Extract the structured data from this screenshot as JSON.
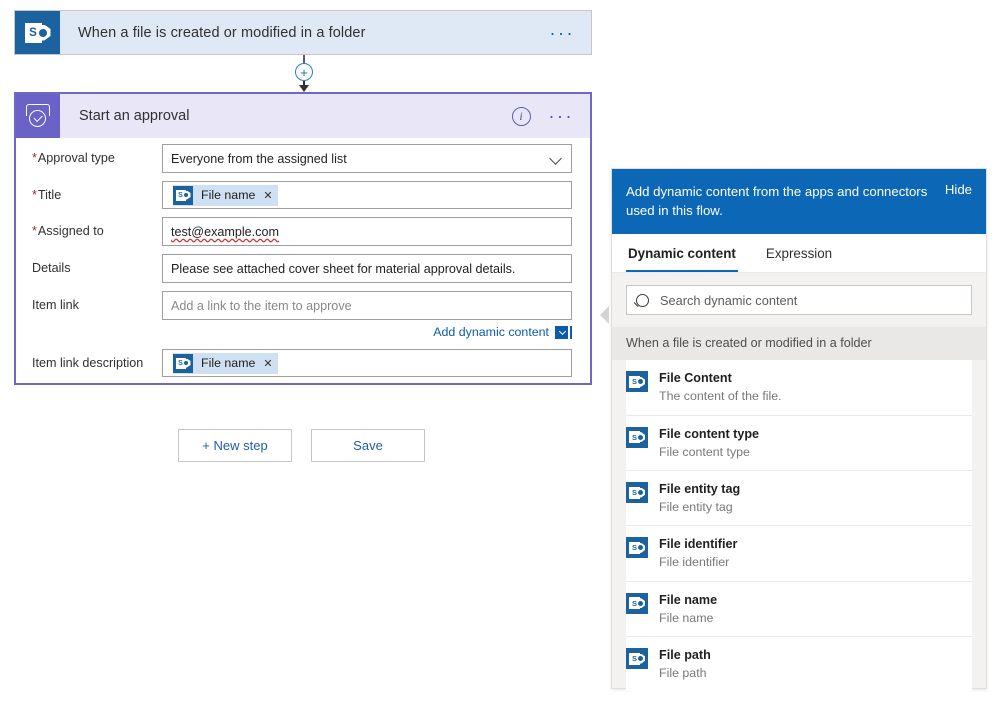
{
  "trigger": {
    "icon": "sharepoint-icon",
    "title": "When a file is created or modified in a folder",
    "menu": "···"
  },
  "connector": {
    "add_label": "+"
  },
  "approval": {
    "icon": "approvals-icon",
    "title": "Start an approval",
    "info": "i",
    "menu": "···",
    "fields": [
      {
        "label": "Approval type",
        "required": true,
        "type": "dropdown",
        "value": "Everyone from the assigned list"
      },
      {
        "label": "Title",
        "required": true,
        "type": "token",
        "token_label": "File name",
        "token_remove": "✕"
      },
      {
        "label": "Assigned to",
        "required": true,
        "type": "text",
        "value": "test@example.com",
        "misspelled": true
      },
      {
        "label": "Details",
        "required": false,
        "type": "text",
        "value": "Please see attached cover sheet for material approval details."
      },
      {
        "label": "Item link",
        "required": false,
        "type": "text",
        "placeholder": "Add a link to the item to approve",
        "value": ""
      },
      {
        "label": "Item link description",
        "required": false,
        "type": "token",
        "token_label": "File name",
        "token_remove": "✕"
      }
    ],
    "add_dynamic_content_link": "Add dynamic content"
  },
  "buttons": {
    "new_step": "+ New step",
    "save": "Save"
  },
  "dynamic_panel": {
    "header_text": "Add dynamic content from the apps and connectors used in this flow.",
    "hide_label": "Hide",
    "tabs": [
      {
        "label": "Dynamic content",
        "active": true
      },
      {
        "label": "Expression",
        "active": false
      }
    ],
    "search_placeholder": "Search dynamic content",
    "group_title": "When a file is created or modified in a folder",
    "items": [
      {
        "name": "File Content",
        "description": "The content of the file."
      },
      {
        "name": "File content type",
        "description": "File content type"
      },
      {
        "name": "File entity tag",
        "description": "File entity tag"
      },
      {
        "name": "File identifier",
        "description": "File identifier"
      },
      {
        "name": "File name",
        "description": "File name"
      },
      {
        "name": "File path",
        "description": "File path"
      }
    ]
  },
  "colors": {
    "sharepoint_blue": "#1b629e",
    "approval_purple": "#6a62c6",
    "panel_header_blue": "#0c67b7",
    "link_blue": "#0b5cab",
    "required_red": "#a4262c"
  }
}
